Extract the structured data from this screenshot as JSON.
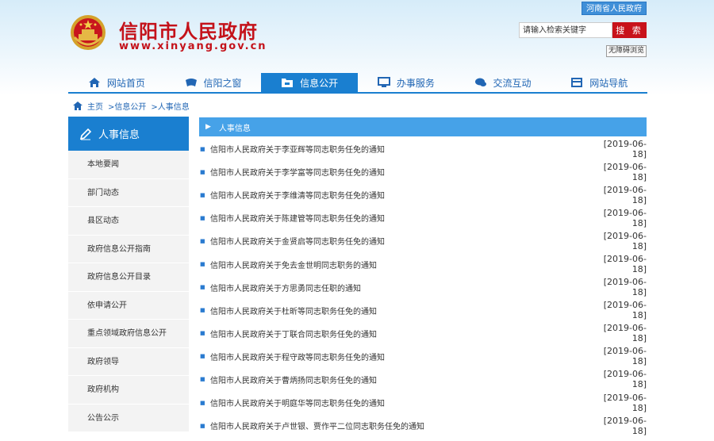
{
  "header": {
    "site_name": "信阳市人民政府",
    "site_domain": "www.xinyang.gov.cn",
    "top_link": "河南省人民政府",
    "search_placeholder": "请输入检索关键字",
    "search_button": "搜 索",
    "accessibility_button": "无障碍浏览"
  },
  "nav": [
    {
      "label": "网站首页",
      "icon": "home-icon",
      "active": false
    },
    {
      "label": "信阳之窗",
      "icon": "window-icon",
      "active": false
    },
    {
      "label": "信息公开",
      "icon": "folder-icon",
      "active": true
    },
    {
      "label": "办事服务",
      "icon": "monitor-icon",
      "active": false
    },
    {
      "label": "交流互动",
      "icon": "chat-icon",
      "active": false
    },
    {
      "label": "网站导航",
      "icon": "sitemap-icon",
      "active": false
    }
  ],
  "breadcrumb": {
    "home": "主页",
    "level1": ">信息公开",
    "level2": ">人事信息"
  },
  "sidebar": {
    "title": "人事信息",
    "items": [
      {
        "label": "本地要闻"
      },
      {
        "label": "部门动态"
      },
      {
        "label": "县区动态"
      },
      {
        "label": "政府信息公开指南"
      },
      {
        "label": "政府信息公开目录"
      },
      {
        "label": "依申请公开"
      },
      {
        "label": "重点领域政府信息公开"
      },
      {
        "label": "政府领导"
      },
      {
        "label": "政府机构"
      },
      {
        "label": "公告公示"
      }
    ]
  },
  "list": {
    "heading": "人事信息",
    "rows": [
      {
        "title": "信阳市人民政府关于李亚辉等同志职务任免的通知",
        "date": "[2019-06-18]"
      },
      {
        "title": "信阳市人民政府关于李学富等同志职务任免的通知",
        "date": "[2019-06-18]"
      },
      {
        "title": "信阳市人民政府关于李维清等同志职务任免的通知",
        "date": "[2019-06-18]"
      },
      {
        "title": "信阳市人民政府关于陈建管等同志职务任免的通知",
        "date": "[2019-06-18]"
      },
      {
        "title": "信阳市人民政府关于金贤启等同志职务任免的通知",
        "date": "[2019-06-18]"
      },
      {
        "title": "信阳市人民政府关于免去金世明同志职务的通知",
        "date": "[2019-06-18]"
      },
      {
        "title": "信阳市人民政府关于方思勇同志任职的通知",
        "date": "[2019-06-18]"
      },
      {
        "title": "信阳市人民政府关于杜昕等同志职务任免的通知",
        "date": "[2019-06-18]"
      },
      {
        "title": "信阳市人民政府关于丁联合同志职务任免的通知",
        "date": "[2019-06-18]"
      },
      {
        "title": "信阳市人民政府关于程守政等同志职务任免的通知",
        "date": "[2019-06-18]"
      },
      {
        "title": "信阳市人民政府关于曹炳扬同志职务任免的通知",
        "date": "[2019-06-18]"
      },
      {
        "title": "信阳市人民政府关于明庭华等同志职务任免的通知",
        "date": "[2019-06-18]"
      },
      {
        "title": "信阳市人民政府关于卢世银、贾作平二位同志职务任免的通知",
        "date": "[2019-06-18]"
      }
    ]
  },
  "colors": {
    "brand_red": "#c4121a",
    "nav_blue": "#1a7fd0",
    "list_head_blue": "#46a2e8"
  }
}
